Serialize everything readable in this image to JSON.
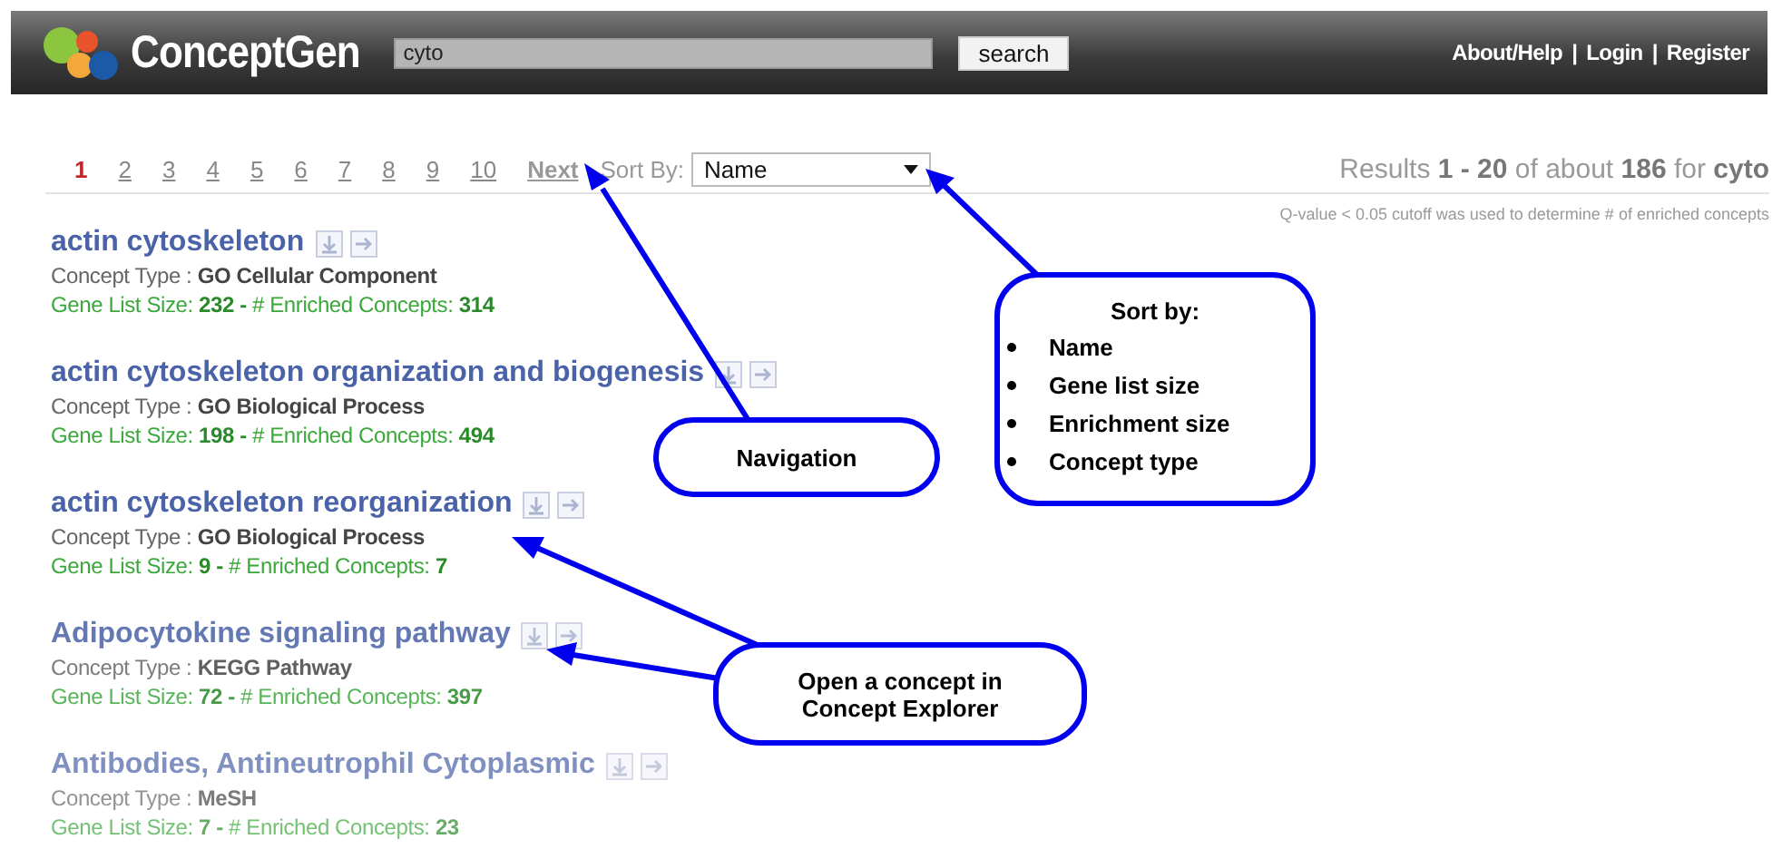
{
  "header": {
    "logo": "ConceptGen",
    "search": {
      "value": "cyto",
      "button": "search"
    },
    "links": [
      "About/Help",
      "Login",
      "Register"
    ],
    "separator": "|"
  },
  "toolbar": {
    "pages": [
      {
        "label": "1",
        "selected": true
      },
      {
        "label": "2",
        "selected": false
      },
      {
        "label": "3",
        "selected": false
      },
      {
        "label": "4",
        "selected": false
      },
      {
        "label": "5",
        "selected": false
      },
      {
        "label": "6",
        "selected": false
      },
      {
        "label": "7",
        "selected": false
      },
      {
        "label": "8",
        "selected": false
      },
      {
        "label": "9",
        "selected": false
      },
      {
        "label": "10",
        "selected": false
      }
    ],
    "next": "Next",
    "sort_label": "Sort By:",
    "sort_value": "Name",
    "results": "Results **1 - 20** of about **186** for **cyto**",
    "note": "Q-value < 0.05 cutoff was used to determine # of enriched concepts"
  },
  "results": [
    {
      "title": "actin cytoskeleton",
      "type": "Concept Type : **GO Cellular Component**",
      "stats": "Gene List Size: **232 -** # Enriched Concepts: **314**"
    },
    {
      "title": "actin cytoskeleton organization and biogenesis",
      "type": "Concept Type : **GO Biological Process**",
      "stats": "Gene List Size: **198 -** # Enriched Concepts: **494**"
    },
    {
      "title": "actin cytoskeleton reorganization",
      "type": "Concept Type : **GO Biological Process**",
      "stats": "Gene List Size: **9 -** # Enriched Concepts: **7**"
    },
    {
      "title": "Adipocytokine signaling pathway",
      "type": "Concept Type : **KEGG Pathway**",
      "stats": "Gene List Size: **72 -** # Enriched Concepts: **397**"
    },
    {
      "title": "Antibodies, Antineutrophil Cytoplasmic",
      "type": "Concept Type : **MeSH**",
      "stats": "Gene List Size: **7 -** # Enriched Concepts: **23**"
    }
  ],
  "callouts": [
    {
      "kind": "plain",
      "text": "Navigation"
    },
    {
      "kind": "list",
      "title": "Sort by:",
      "items": [
        "Name",
        "Gene list size",
        "Enrichment size",
        "Concept type"
      ]
    },
    {
      "kind": "plain",
      "text": "Open a concept in Concept Explorer"
    }
  ]
}
